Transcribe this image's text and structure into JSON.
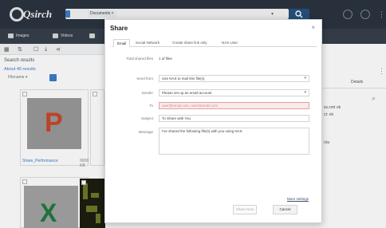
{
  "app": {
    "logo_text": "Qsirch",
    "search_tag": "",
    "search_term": "Documents ×",
    "search_dropdown": "▾"
  },
  "toolbar2": {
    "items": [
      {
        "label": "Images"
      },
      {
        "label": "Videos"
      },
      {
        "label": ""
      }
    ]
  },
  "left": {
    "results_title": "Search results",
    "results_count": "About 46 results",
    "filter_label": "Filename ▾",
    "thumbs": [
      {
        "letter": "P",
        "name": "Share_Performance",
        "size": "9008 KB"
      },
      {
        "letter": "X",
        "name": "",
        "size": ""
      }
    ]
  },
  "right": {
    "col_header": "Details",
    "text1": "ss.cmt  ok",
    "text2": "ct: ok",
    "text3": "n/a",
    "search_icon": "search-icon"
  },
  "dialog": {
    "title": "Share",
    "close": "×",
    "tabs": [
      {
        "label": "Email",
        "active": true
      },
      {
        "label": "Social Network",
        "active": false
      },
      {
        "label": "Create share link only",
        "active": false
      },
      {
        "label": "NAS User",
        "active": false
      }
    ],
    "total_label": "Total shared files",
    "total_value": "1 of files",
    "rows": [
      {
        "label": "Send from",
        "value": "Use NAS to mail this file(s)",
        "dropdown": true,
        "error": false
      },
      {
        "label": "Sender",
        "value": "Please set up an email account",
        "dropdown": true,
        "error": false
      },
      {
        "label": "To",
        "value": "user@email.com, user@email.com",
        "dropdown": false,
        "error": true
      },
      {
        "label": "Subject",
        "value": "To Share with You",
        "dropdown": false,
        "error": false
      }
    ],
    "message_label": "Message",
    "message_value": "I've shared the following file(s) with you using NAS",
    "more_link": "More settings",
    "share_button": "Share Now",
    "cancel_button": "Cancel"
  },
  "colors": {
    "appbar": "#2b3440",
    "accent": "#3d7cc9",
    "search_button": "#26527f"
  }
}
